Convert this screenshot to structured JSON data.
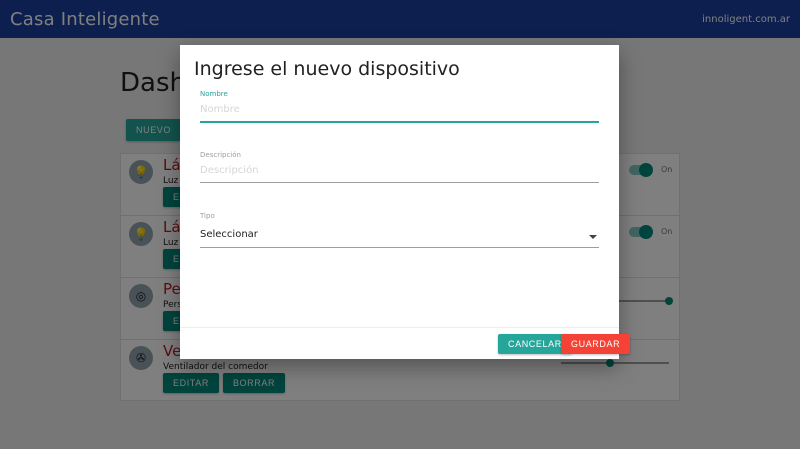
{
  "navbar": {
    "brand": "Casa Inteligente",
    "site_link": "innoligent.com.ar"
  },
  "page": {
    "title": "Dash",
    "new_button": "NUEVO",
    "devices": [
      {
        "name": "Lá",
        "description": "Luz",
        "icon": "lightbulb-icon",
        "control": "toggle",
        "state_label": "On",
        "edit": "EDI",
        "delete": ""
      },
      {
        "name": "Lá",
        "description": "Luz",
        "icon": "lightbulb-icon",
        "control": "toggle",
        "state_label": "On",
        "edit": "E",
        "delete": ""
      },
      {
        "name": "Pe",
        "description": "Pers",
        "icon": "blinds-icon",
        "control": "slider",
        "level": 1.0,
        "edit": "E",
        "delete": ""
      },
      {
        "name": "Ve",
        "description": "Ventilador del comedor",
        "icon": "fan-icon",
        "control": "slider",
        "level": 0.45,
        "edit": "EDITAR",
        "delete": "BORRAR"
      }
    ]
  },
  "modal": {
    "title": "Ingrese el nuevo dispositivo",
    "nombre": {
      "label": "Nombre",
      "placeholder": "Nombre",
      "value": ""
    },
    "descripcion": {
      "label": "Descripción",
      "placeholder": "Descripción",
      "value": ""
    },
    "tipo": {
      "label": "Tipo",
      "selected": "Seleccionar"
    },
    "cancel_label": "CANCELAR",
    "save_label": "GUARDAR"
  },
  "colors": {
    "navbar": "#1a3f9e",
    "accent": "#26a69a",
    "danger": "#f44336",
    "device_name": "#b71c1c"
  }
}
